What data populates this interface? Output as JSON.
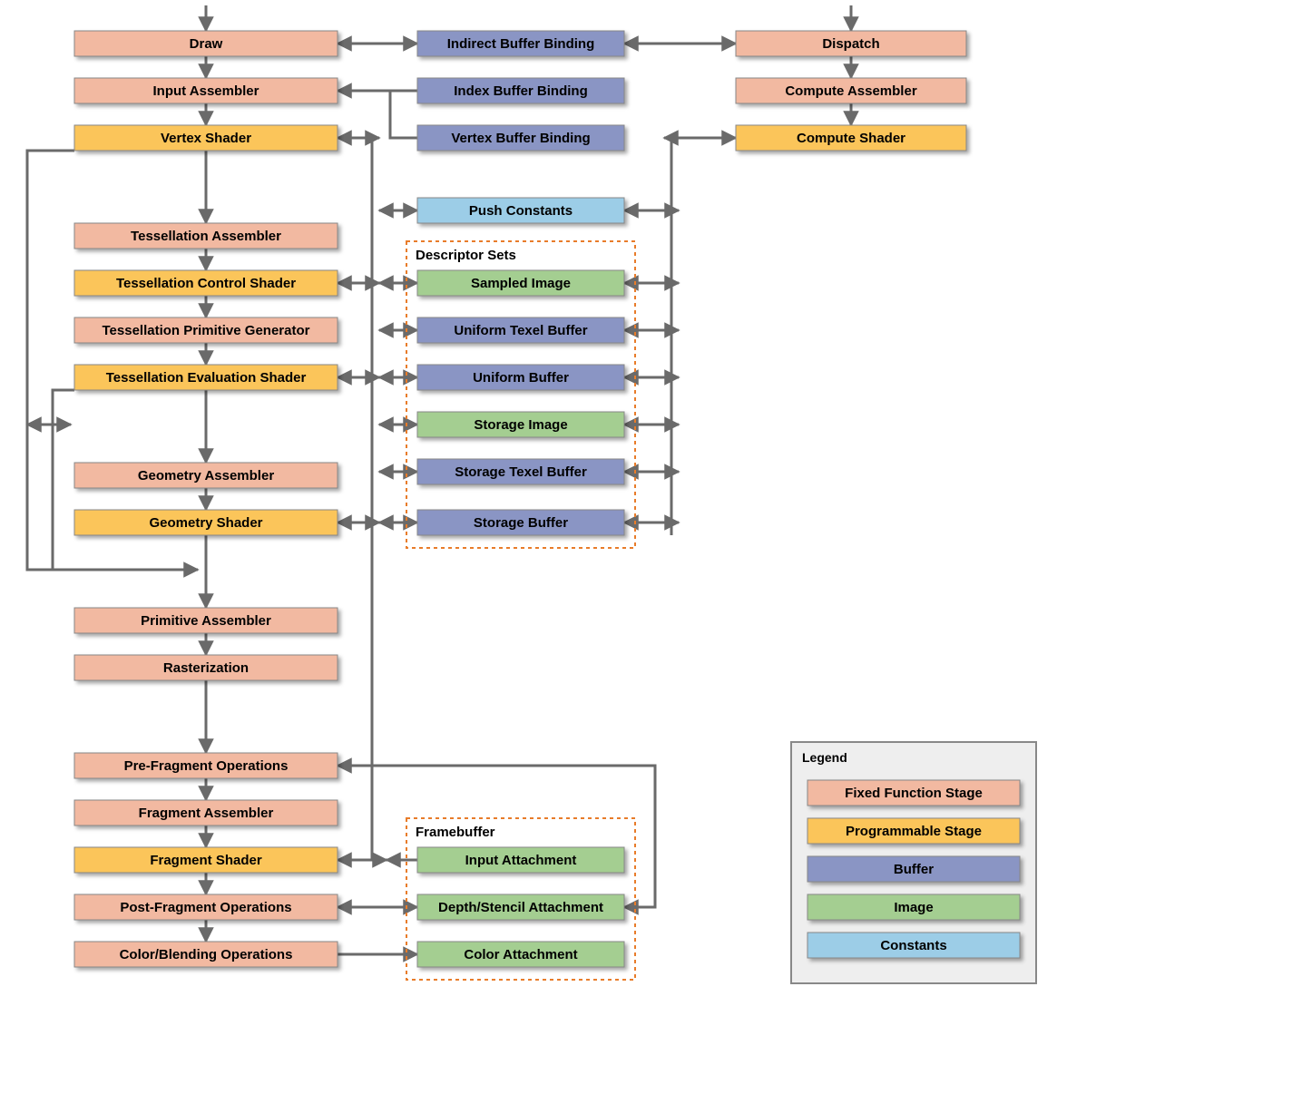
{
  "left_column": {
    "draw": "Draw",
    "input_assembler": "Input Assembler",
    "vertex_shader": "Vertex Shader",
    "tess_assembler": "Tessellation Assembler",
    "tess_control": "Tessellation Control Shader",
    "tess_primgen": "Tessellation Primitive Generator",
    "tess_eval": "Tessellation Evaluation Shader",
    "geom_assembler": "Geometry Assembler",
    "geom_shader": "Geometry Shader",
    "prim_assembler": "Primitive Assembler",
    "rasterization": "Rasterization",
    "pre_frag": "Pre-Fragment Operations",
    "frag_assembler": "Fragment Assembler",
    "frag_shader": "Fragment Shader",
    "post_frag": "Post-Fragment Operations",
    "color_blend": "Color/Blending Operations"
  },
  "center_column": {
    "indirect_buffer": "Indirect Buffer Binding",
    "index_buffer": "Index Buffer Binding",
    "vertex_buffer": "Vertex Buffer Binding",
    "push_constants": "Push Constants",
    "descriptor_sets_title": "Descriptor Sets",
    "sampled_image": "Sampled Image",
    "uniform_texel": "Uniform Texel Buffer",
    "uniform_buffer": "Uniform Buffer",
    "storage_image": "Storage Image",
    "storage_texel": "Storage Texel Buffer",
    "storage_buffer": "Storage Buffer",
    "framebuffer_title": "Framebuffer",
    "input_attach": "Input Attachment",
    "depth_attach": "Depth/Stencil Attachment",
    "color_attach": "Color Attachment"
  },
  "right_column": {
    "dispatch": "Dispatch",
    "compute_assembler": "Compute Assembler",
    "compute_shader": "Compute Shader"
  },
  "legend": {
    "title": "Legend",
    "fixed": "Fixed Function Stage",
    "prog": "Programmable Stage",
    "buffer": "Buffer",
    "image": "Image",
    "constants": "Constants"
  },
  "colors": {
    "fixed": "#f2b9a1",
    "programmable": "#fbc55a",
    "buffer": "#8a95c4",
    "image": "#a4ce91",
    "constants": "#9ccde7",
    "group_border": "#e87c2a",
    "connector": "#6a6a6a"
  }
}
